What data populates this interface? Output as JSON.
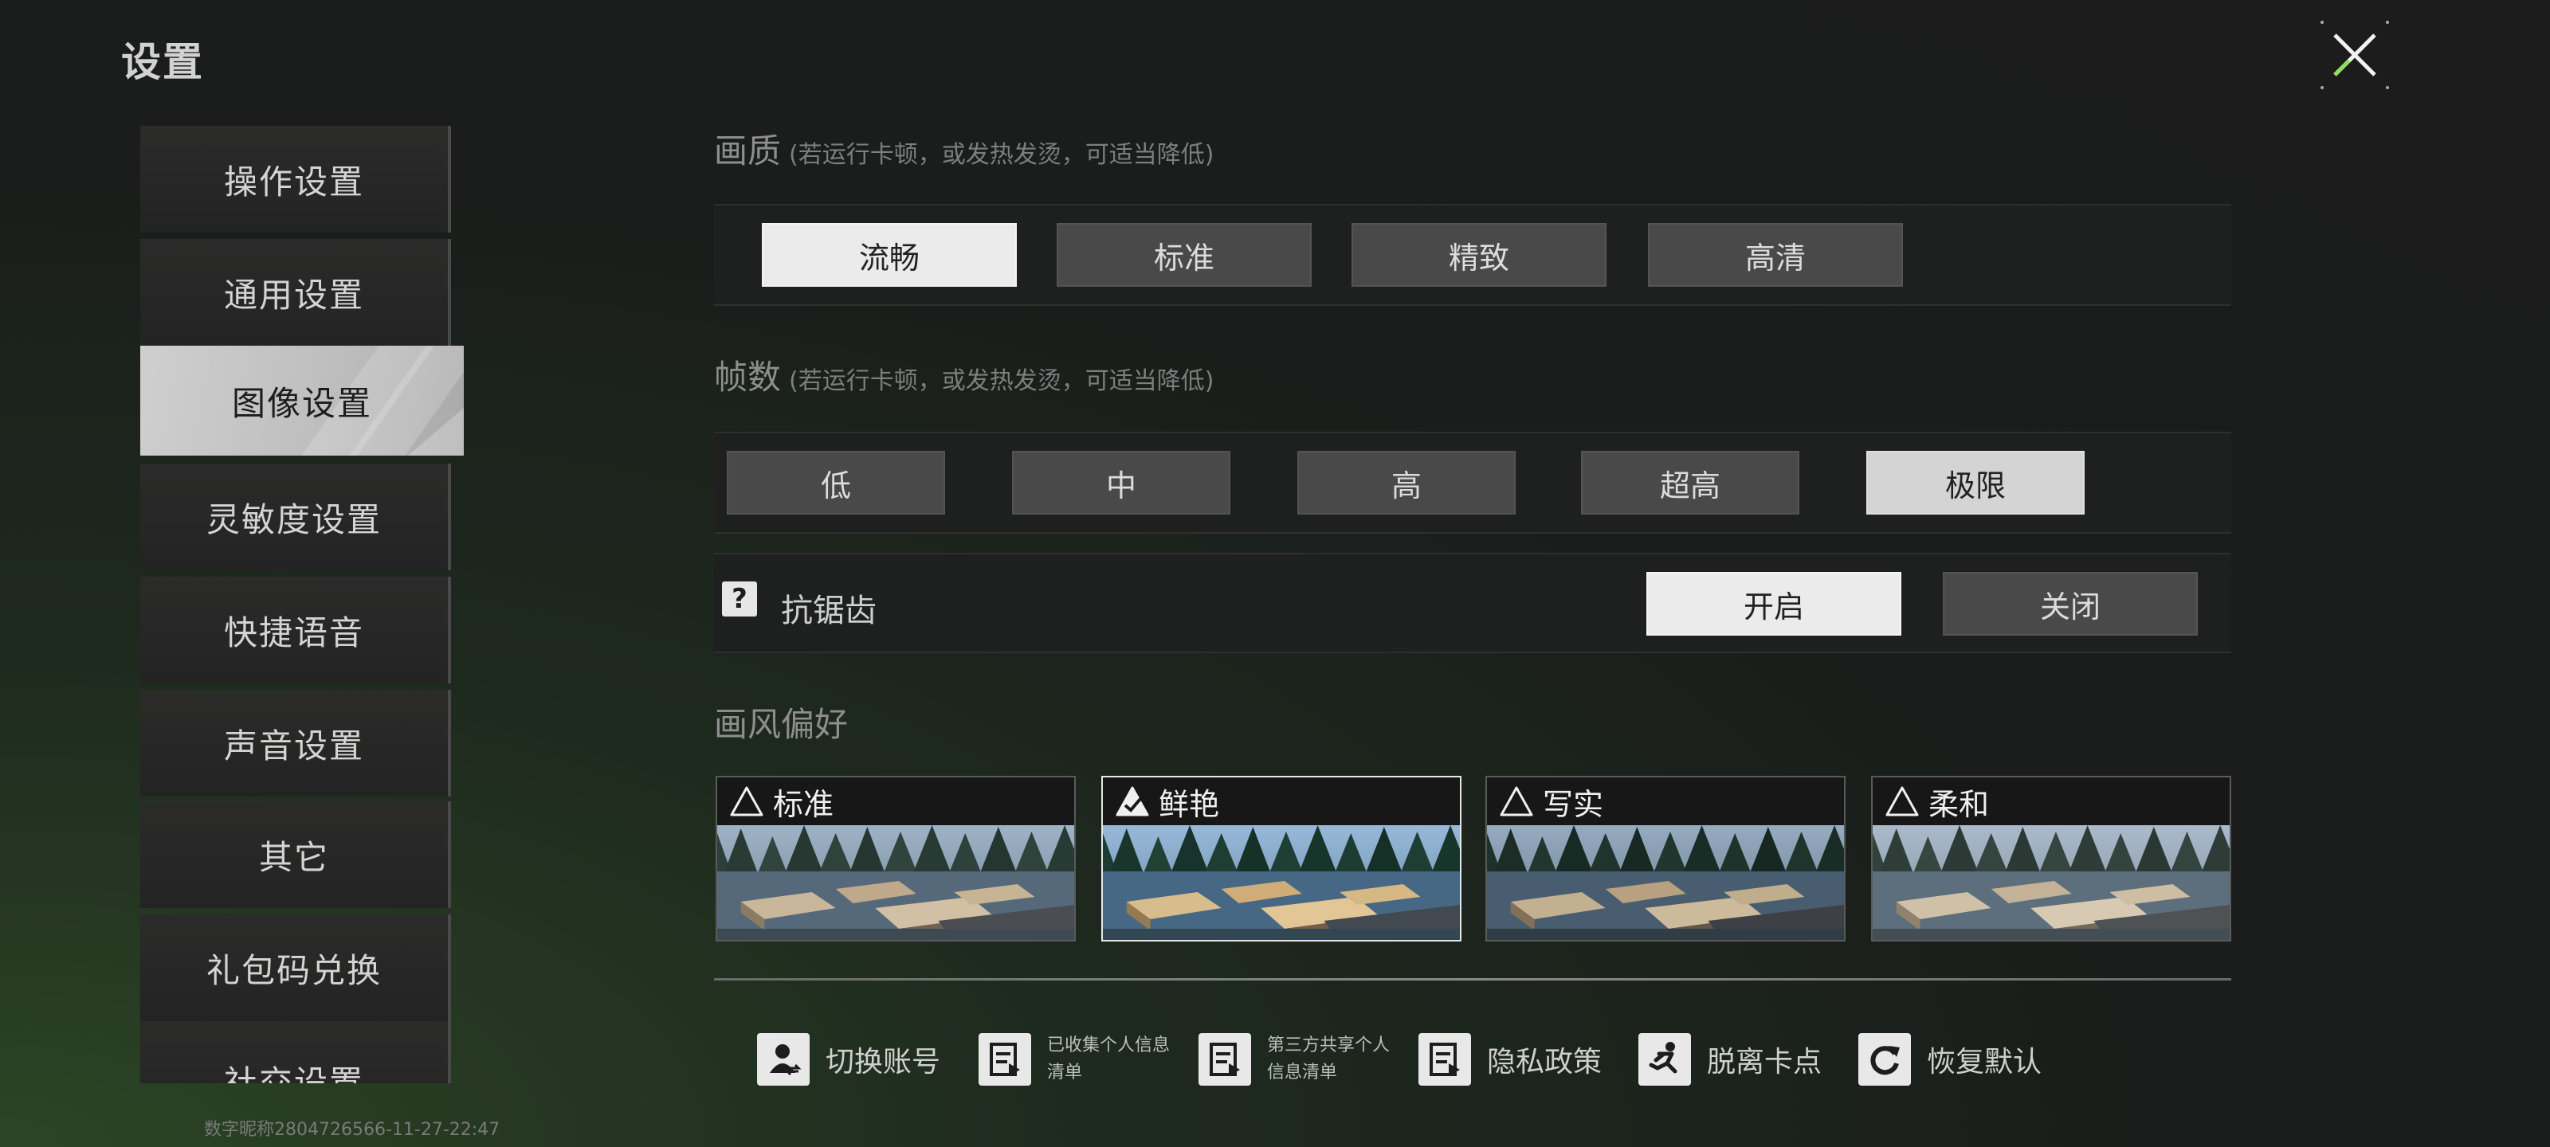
{
  "page": {
    "title": "设置"
  },
  "sidebar": {
    "items": [
      {
        "label": "操作设置"
      },
      {
        "label": "通用设置"
      },
      {
        "label": "图像设置",
        "active": true
      },
      {
        "label": "灵敏度设置"
      },
      {
        "label": "快捷语音"
      },
      {
        "label": "声音设置"
      },
      {
        "label": "其它"
      },
      {
        "label": "礼包码兑换"
      },
      {
        "label": "社交设置"
      }
    ],
    "footer_id": "数字昵称2804726566-11-27-22:47"
  },
  "quality": {
    "label": "画质",
    "hint": "(若运行卡顿，或发热发烫，可适当降低)",
    "options": [
      "流畅",
      "标准",
      "精致",
      "高清"
    ],
    "selected": "流畅"
  },
  "framerate": {
    "label": "帧数",
    "hint": "(若运行卡顿，或发热发烫，可适当降低)",
    "options": [
      "低",
      "中",
      "高",
      "超高",
      "极限"
    ],
    "selected": "极限"
  },
  "antialias": {
    "label": "抗锯齿",
    "help_icon": "?",
    "on_label": "开启",
    "off_label": "关闭",
    "selected": "开启"
  },
  "style": {
    "label": "画风偏好",
    "options": [
      "标准",
      "鲜艳",
      "写实",
      "柔和"
    ],
    "selected": "鲜艳"
  },
  "bottom_bar": {
    "items": [
      {
        "label": "切换账号",
        "icon": "switch-account-icon"
      },
      {
        "label": "已收集个人信息清单",
        "icon": "document-icon"
      },
      {
        "label": "第三方共享个人信息清单",
        "icon": "document-icon"
      },
      {
        "label": "隐私政策",
        "icon": "document-icon"
      },
      {
        "label": "脱离卡点",
        "icon": "running-man-icon"
      },
      {
        "label": "恢复默认",
        "icon": "refresh-icon"
      }
    ]
  },
  "colors": {
    "accent_green": "#7ed957",
    "selected_bg": "#ebebeb",
    "button_bg": "#484948"
  }
}
